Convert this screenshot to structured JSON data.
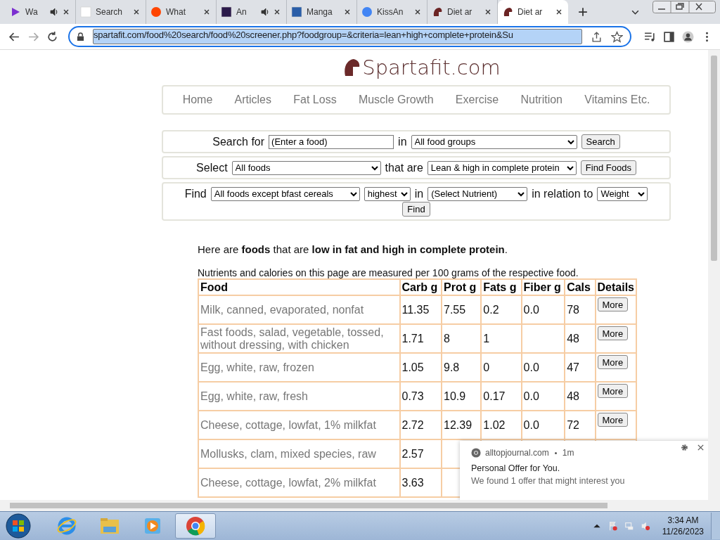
{
  "browser": {
    "tabs": [
      {
        "title": "Wa",
        "kind": "play",
        "audio": true,
        "selected": false
      },
      {
        "title": "Search",
        "kind": "blank",
        "audio": false,
        "selected": false
      },
      {
        "title": "What",
        "kind": "reddit",
        "audio": false,
        "selected": false
      },
      {
        "title": "An",
        "kind": "square",
        "audio": true,
        "selected": false
      },
      {
        "title": "Manga",
        "kind": "manga",
        "audio": false,
        "selected": false
      },
      {
        "title": "KissAn",
        "kind": "google",
        "audio": false,
        "selected": false
      },
      {
        "title": "Diet ar",
        "kind": "helmet",
        "audio": false,
        "selected": false
      },
      {
        "title": "Diet ar",
        "kind": "helmet",
        "audio": false,
        "selected": true
      }
    ],
    "url": "spartafit.com/food%20search/food%20screener.php?foodgroup=&criteria=lean+high+complete+protein&Su",
    "url_selected": true
  },
  "site": {
    "logo": "Spartafit.com",
    "nav": [
      "Home",
      "Articles",
      "Fat Loss",
      "Muscle Growth",
      "Exercise",
      "Nutrition",
      "Vitamins Etc."
    ]
  },
  "search_form": {
    "label": "Search for",
    "value": "(Enter a food)",
    "in_label": "in",
    "group": "All food groups",
    "button": "Search"
  },
  "select_form": {
    "label": "Select",
    "foods": "All foods",
    "that_label": "that are",
    "criteria": "Lean & high in complete protein",
    "button": "Find Foods"
  },
  "find_form": {
    "label": "Find",
    "foods": "All foods except bfast cereals",
    "order": "highest",
    "in_label": "in",
    "nutrient": "(Select Nutrient)",
    "relation_label": "in relation to",
    "basis": "Weight",
    "button": "Find"
  },
  "intro": "Here are **foods** that are **low in fat and high in complete protein**.",
  "note": "Nutrients and calories on this page are measured per 100 grams of the respective food.",
  "table": {
    "columns": [
      "Food",
      "Carb g",
      "Prot g",
      "Fats g",
      "Fiber g",
      "Cals",
      "Details"
    ],
    "rows": [
      {
        "cells": [
          "Milk, canned, evaporated, nonfat",
          "11.35",
          "7.55",
          "0.2",
          "0.0",
          "78"
        ],
        "button": "More"
      },
      {
        "cells": [
          "Fast foods, salad, vegetable, tossed, without dressing, with chicken",
          "1.71",
          "8",
          "1",
          null,
          "48"
        ],
        "button": "More"
      },
      {
        "cells": [
          "Egg, white, raw, frozen",
          "1.05",
          "9.8",
          "0",
          "0.0",
          "47"
        ],
        "button": "More"
      },
      {
        "cells": [
          "Egg, white, raw, fresh",
          "0.73",
          "10.9",
          "0.17",
          "0.0",
          "48"
        ],
        "button": "More"
      },
      {
        "cells": [
          "Cheese, cottage, lowfat, 1% milkfat",
          "2.72",
          "12.39",
          "1.02",
          "0.0",
          "72"
        ],
        "button": "More"
      },
      {
        "cells": [
          "Mollusks, clam, mixed species, raw",
          "2.57"
        ]
      },
      {
        "cells": [
          "Cheese, cottage, lowfat, 2% milkfat",
          "3.63"
        ]
      }
    ]
  },
  "notification": {
    "source": "alltopjournal.com",
    "time": "1m",
    "title": "Personal Offer for You.",
    "body": "We found 1 offer that might interest you"
  },
  "taskbar": {
    "apps": [
      {
        "kind": "ie",
        "selected": false
      },
      {
        "kind": "folder",
        "selected": false
      },
      {
        "kind": "media",
        "selected": false
      },
      {
        "kind": "chrome",
        "selected": true
      }
    ],
    "time": "3:34 AM",
    "date": "11/26/2023"
  }
}
